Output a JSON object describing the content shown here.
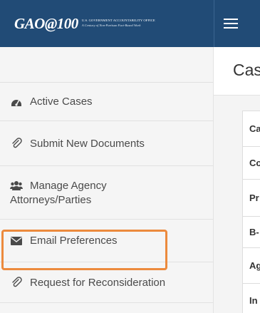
{
  "header": {
    "logo_text": "GAO@100",
    "logo_tagline_1": "U.S. GOVERNMENT ACCOUNTABILITY OFFICE",
    "logo_tagline_2": "A Century of Non-Partisan Fact-Based Work"
  },
  "sidebar": {
    "items": [
      {
        "label": "Active Cases",
        "icon": "tachometer-icon"
      },
      {
        "label": "Submit New Documents",
        "icon": "paperclip-icon"
      },
      {
        "label_line1": "Manage Agency",
        "label_line2": "Attorneys/Parties",
        "icon": "users-icon"
      },
      {
        "label": "Email Preferences",
        "icon": "envelope-icon",
        "highlighted": true
      },
      {
        "label": "Request for Reconsideration",
        "icon": "paperclip-icon"
      }
    ]
  },
  "main": {
    "title": "Cas",
    "table_rows": [
      "Ca",
      "Co",
      "Pr",
      "B-",
      "Ag",
      "In"
    ]
  },
  "colors": {
    "header_bg": "#214b76",
    "sidebar_bg": "#f5f5f5",
    "highlight": "#ec8a3d"
  }
}
